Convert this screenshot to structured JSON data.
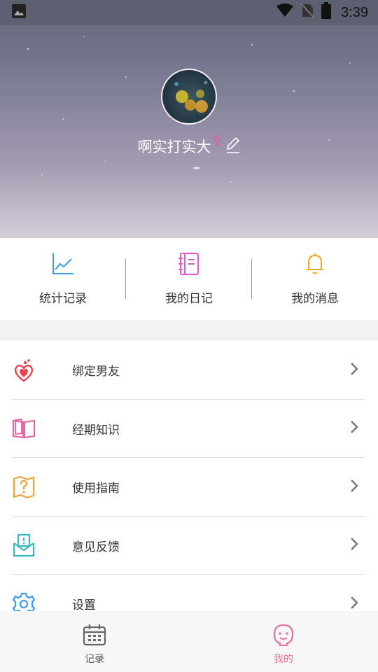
{
  "status_bar": {
    "time": "3:39",
    "left_icon": "image-icon",
    "right_icons": [
      "wifi-icon",
      "no-sim-icon",
      "battery-icon"
    ]
  },
  "profile": {
    "username": "啊实打实大",
    "gender_icon": "female-icon",
    "edit_icon": "pencil-icon"
  },
  "quick_nav": [
    {
      "label": "统计记录",
      "icon": "line-chart-icon",
      "color": "#3d9be9"
    },
    {
      "label": "我的日记",
      "icon": "notebook-icon",
      "color": "#e858c8"
    },
    {
      "label": "我的消息",
      "icon": "bell-icon",
      "color": "#f5a623"
    }
  ],
  "menu": [
    {
      "label": "绑定男友",
      "icon": "hearts-icon",
      "color": "#e8424f"
    },
    {
      "label": "经期知识",
      "icon": "book-icon",
      "color": "#e36aa4"
    },
    {
      "label": "使用指南",
      "icon": "guide-map-icon",
      "color": "#f0a33a"
    },
    {
      "label": "意见反馈",
      "icon": "feedback-mail-icon",
      "color": "#3cb8c2"
    },
    {
      "label": "设置",
      "icon": "gear-icon",
      "color": "#3d9be9"
    }
  ],
  "tabbar": [
    {
      "label": "记录",
      "icon": "calendar-icon",
      "active": false
    },
    {
      "label": "我的",
      "icon": "face-icon",
      "active": true
    }
  ],
  "colors": {
    "accent_pink": "#e9709a",
    "text": "#333333"
  }
}
